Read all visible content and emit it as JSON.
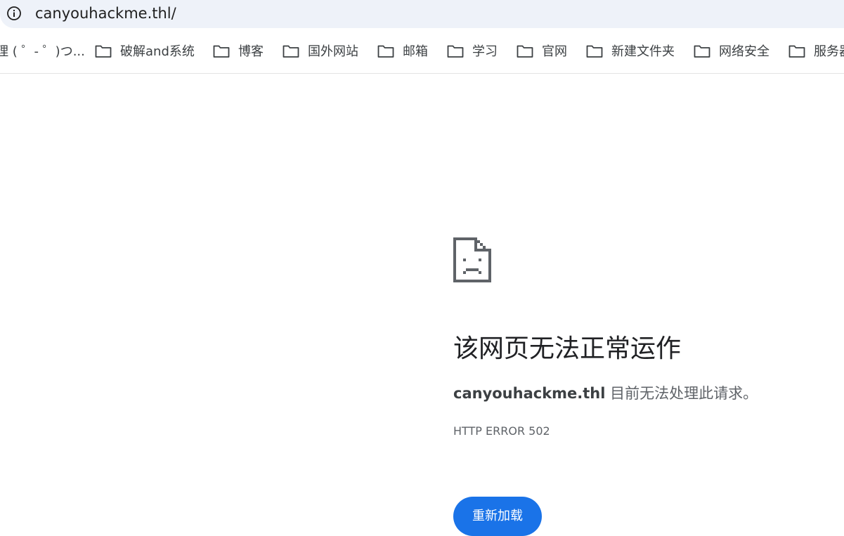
{
  "omnibox": {
    "url": "canyouhackme.thl/",
    "info_icon": "info-circle-icon"
  },
  "bookmarks": {
    "truncated_first": "理 ( ゜- ゜)つ...",
    "items": [
      {
        "label": "破解and系统",
        "icon": "folder-icon"
      },
      {
        "label": "博客",
        "icon": "folder-icon"
      },
      {
        "label": "国外网站",
        "icon": "folder-icon"
      },
      {
        "label": "邮箱",
        "icon": "folder-icon"
      },
      {
        "label": "学习",
        "icon": "folder-icon"
      },
      {
        "label": "官网",
        "icon": "folder-icon"
      },
      {
        "label": "新建文件夹",
        "icon": "folder-icon"
      },
      {
        "label": "网络安全",
        "icon": "folder-icon"
      },
      {
        "label": "服务器",
        "icon": "folder-icon"
      }
    ]
  },
  "error": {
    "icon": "sad-page-icon",
    "title": "该网页无法正常运作",
    "host": "canyouhackme.thl",
    "message": " 目前无法处理此请求。",
    "code": "HTTP ERROR 502",
    "reload_label": "重新加载"
  },
  "colors": {
    "accent": "#1a73e8",
    "omnibox_bg": "#eef2f9"
  }
}
